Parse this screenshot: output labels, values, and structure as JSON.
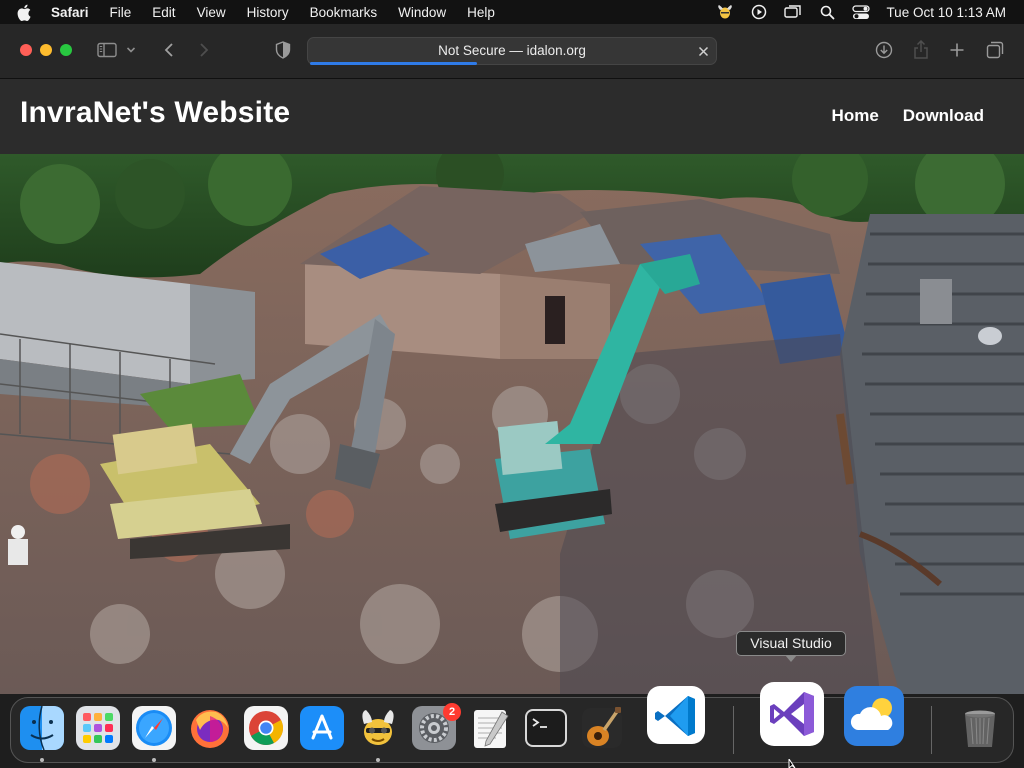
{
  "menubar": {
    "app_name": "Safari",
    "items": [
      "File",
      "Edit",
      "View",
      "History",
      "Bookmarks",
      "Window",
      "Help"
    ],
    "clock": "Tue Oct 10  1:13 AM"
  },
  "browser": {
    "address": "Not Secure — idalon.org",
    "load_progress": 0.41
  },
  "site": {
    "title": "InvraNet's Website",
    "nav": [
      "Home",
      "Download"
    ]
  },
  "tooltip": "Visual Studio",
  "dock": {
    "settings_badge": "2",
    "items": [
      "Finder",
      "Launchpad",
      "Safari",
      "Firefox",
      "Chrome",
      "App Store",
      "Cyberduck",
      "System Settings",
      "TextEdit",
      "Terminal",
      "GarageBand",
      "Visual Studio Code",
      "Visual Studio",
      "Weather",
      "Trash"
    ]
  },
  "colors": {
    "close": "#ff5f57",
    "minimize": "#febc2e",
    "maximize": "#28c840",
    "progress": "#2f7be8"
  }
}
